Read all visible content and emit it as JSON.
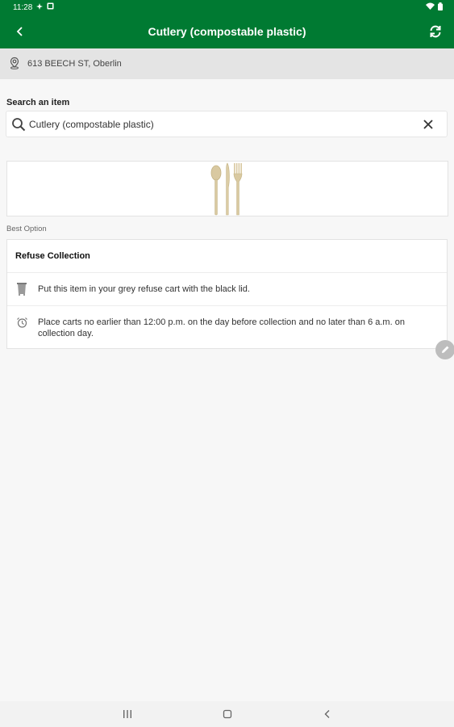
{
  "status_bar": {
    "time": "11:28"
  },
  "app_bar": {
    "title": "Cutlery (compostable plastic)"
  },
  "address": {
    "text": "613 BEECH ST, Oberlin"
  },
  "search": {
    "label": "Search an item",
    "value": "Cutlery (compostable plastic)"
  },
  "item": {
    "image": "cutlery-image"
  },
  "best_option_label": "Best Option",
  "option_card": {
    "title": "Refuse Collection",
    "instructions": [
      {
        "icon": "refuse-cart-icon",
        "text": "Put this item in your grey refuse cart with the black lid."
      },
      {
        "icon": "alarm-clock-icon",
        "text": "Place carts no earlier than 12:00 p.m. on the day before collection and no later than 6 a.m. on collection day."
      }
    ]
  },
  "colors": {
    "brand_green": "#007a32",
    "address_bg": "#e4e4e4"
  }
}
